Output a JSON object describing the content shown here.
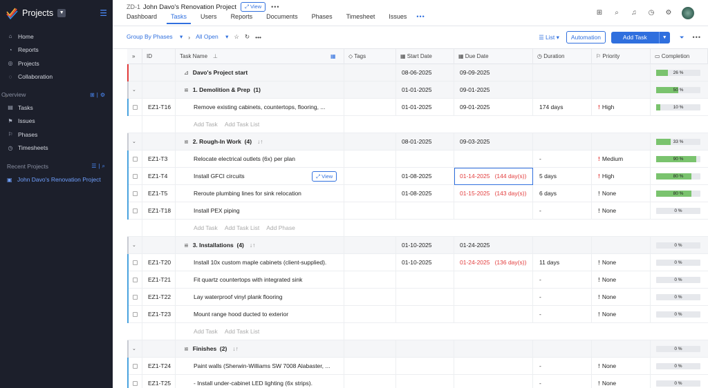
{
  "sidebar": {
    "app_title": "Projects",
    "nav": [
      {
        "label": "Home",
        "icon": "home-icon"
      },
      {
        "label": "Reports",
        "icon": "reports-icon"
      },
      {
        "label": "Projects",
        "icon": "projects-icon"
      },
      {
        "label": "Collaboration",
        "icon": "collaboration-icon"
      }
    ],
    "overview_title": "Overview",
    "overview_items": [
      {
        "label": "Tasks",
        "icon": "tasks-icon"
      },
      {
        "label": "Issues",
        "icon": "issues-icon"
      },
      {
        "label": "Phases",
        "icon": "phases-icon"
      },
      {
        "label": "Timesheets",
        "icon": "timesheets-icon"
      }
    ],
    "recent_title": "Recent Projects",
    "recent_items": [
      {
        "label": "John Davo's Renovation Project"
      }
    ]
  },
  "header": {
    "project_id": "ZD-1",
    "project_name": "John Davo's Renovation Project",
    "view_label": "View",
    "tabs": [
      "Dashboard",
      "Tasks",
      "Users",
      "Reports",
      "Documents",
      "Phases",
      "Timesheet",
      "Issues"
    ],
    "active_tab": "Tasks"
  },
  "toolbar": {
    "group_by": "Group By Phases",
    "filter": "All Open",
    "list_label": "List",
    "automation_label": "Automation",
    "add_task_label": "Add Task"
  },
  "table": {
    "columns": [
      "ID",
      "Task Name",
      "Tags",
      "Start Date",
      "Due Date",
      "Duration",
      "Priority",
      "Completion"
    ],
    "add_task": "Add Task",
    "add_task_list": "Add Task List",
    "add_phase": "Add Phase",
    "view_label": "View",
    "rows": [
      {
        "kind": "project",
        "name": "Davo's Project start",
        "start": "08-06-2025",
        "due": "09-09-2025",
        "completion": 26,
        "completion_label": "26 %"
      },
      {
        "kind": "group",
        "name": "1. Demolition & Prep",
        "count": "(1)",
        "start": "01-01-2025",
        "due": "09-01-2025",
        "completion": 50,
        "completion_label": "50 %"
      },
      {
        "kind": "task",
        "id": "EZ1-T16",
        "name": "Remove existing cabinets, countertops, flooring, ...",
        "start": "01-01-2025",
        "due": "09-01-2025",
        "duration": "174 days",
        "priority": "High",
        "completion": 10,
        "completion_label": "10 %",
        "bar": "#4aa3df"
      },
      {
        "kind": "add",
        "phase": false
      },
      {
        "kind": "group",
        "name": "2. Rough-In Work",
        "count": "(4)",
        "start": "08-01-2025",
        "due": "09-03-2025",
        "completion": 33,
        "completion_label": "33 %"
      },
      {
        "kind": "task",
        "id": "EZ1-T3",
        "name": "Relocate electrical outlets (6x) per plan",
        "start": "",
        "due": "",
        "duration": "-",
        "priority": "Medium",
        "completion": 90,
        "completion_label": "90 %",
        "bar": "#4aa3df"
      },
      {
        "kind": "task",
        "id": "EZ1-T4",
        "name": "Install GFCI circuits",
        "start": "01-08-2025",
        "due": "01-14-2025",
        "overdue": "(144 day(s))",
        "duration": "5 days",
        "priority": "High",
        "completion": 80,
        "completion_label": "80 %",
        "bar": "#4aa3df",
        "hover": true
      },
      {
        "kind": "task",
        "id": "EZ1-T5",
        "name": "Reroute plumbing lines for sink relocation",
        "start": "01-08-2025",
        "due": "01-15-2025",
        "overdue": "(143 day(s))",
        "duration": "6 days",
        "priority": "None",
        "completion": 80,
        "completion_label": "80 %",
        "bar": "#4aa3df"
      },
      {
        "kind": "task",
        "id": "EZ1-T18",
        "name": "Install PEX piping",
        "start": "",
        "due": "",
        "duration": "-",
        "priority": "None",
        "completion": 0,
        "completion_label": "0 %",
        "bar": "#4aa3df"
      },
      {
        "kind": "add",
        "phase": true
      },
      {
        "kind": "group",
        "name": "3. Installations",
        "count": "(4)",
        "start": "01-10-2025",
        "due": "01-24-2025",
        "completion": 0,
        "completion_label": "0 %"
      },
      {
        "kind": "task",
        "id": "EZ1-T20",
        "name": "Install 10x custom maple cabinets (client-supplied).",
        "start": "01-10-2025",
        "due": "01-24-2025",
        "overdue": "(136 day(s))",
        "duration": "11 days",
        "priority": "None",
        "completion": 0,
        "completion_label": "0 %",
        "bar": "#4aa3df"
      },
      {
        "kind": "task",
        "id": "EZ1-T21",
        "name": "Fit quartz countertops with integrated sink",
        "start": "",
        "due": "",
        "duration": "-",
        "priority": "None",
        "completion": 0,
        "completion_label": "0 %",
        "bar": "#4aa3df"
      },
      {
        "kind": "task",
        "id": "EZ1-T22",
        "name": "Lay waterproof vinyl plank flooring",
        "start": "",
        "due": "",
        "duration": "-",
        "priority": "None",
        "completion": 0,
        "completion_label": "0 %",
        "bar": "#4aa3df"
      },
      {
        "kind": "task",
        "id": "EZ1-T23",
        "name": "Mount range hood ducted to exterior",
        "start": "",
        "due": "",
        "duration": "-",
        "priority": "None",
        "completion": 0,
        "completion_label": "0 %",
        "bar": "#4aa3df"
      },
      {
        "kind": "add",
        "phase": false
      },
      {
        "kind": "group",
        "name": "Finishes",
        "count": "(2)",
        "start": "",
        "due": "",
        "completion": 0,
        "completion_label": "0 %"
      },
      {
        "kind": "task",
        "id": "EZ1-T24",
        "name": "Paint walls (Sherwin-Williams SW 7008 Alabaster, ...",
        "start": "",
        "due": "",
        "duration": "-",
        "priority": "None",
        "completion": 0,
        "completion_label": "0 %",
        "bar": "#4aa3df"
      },
      {
        "kind": "task",
        "id": "EZ1-T25",
        "name": "- Install under-cabinet LED lighting (6x strips).",
        "start": "",
        "due": "",
        "duration": "-",
        "priority": "None",
        "completion": 0,
        "completion_label": "0 %",
        "bar": "#4aa3df"
      }
    ]
  }
}
